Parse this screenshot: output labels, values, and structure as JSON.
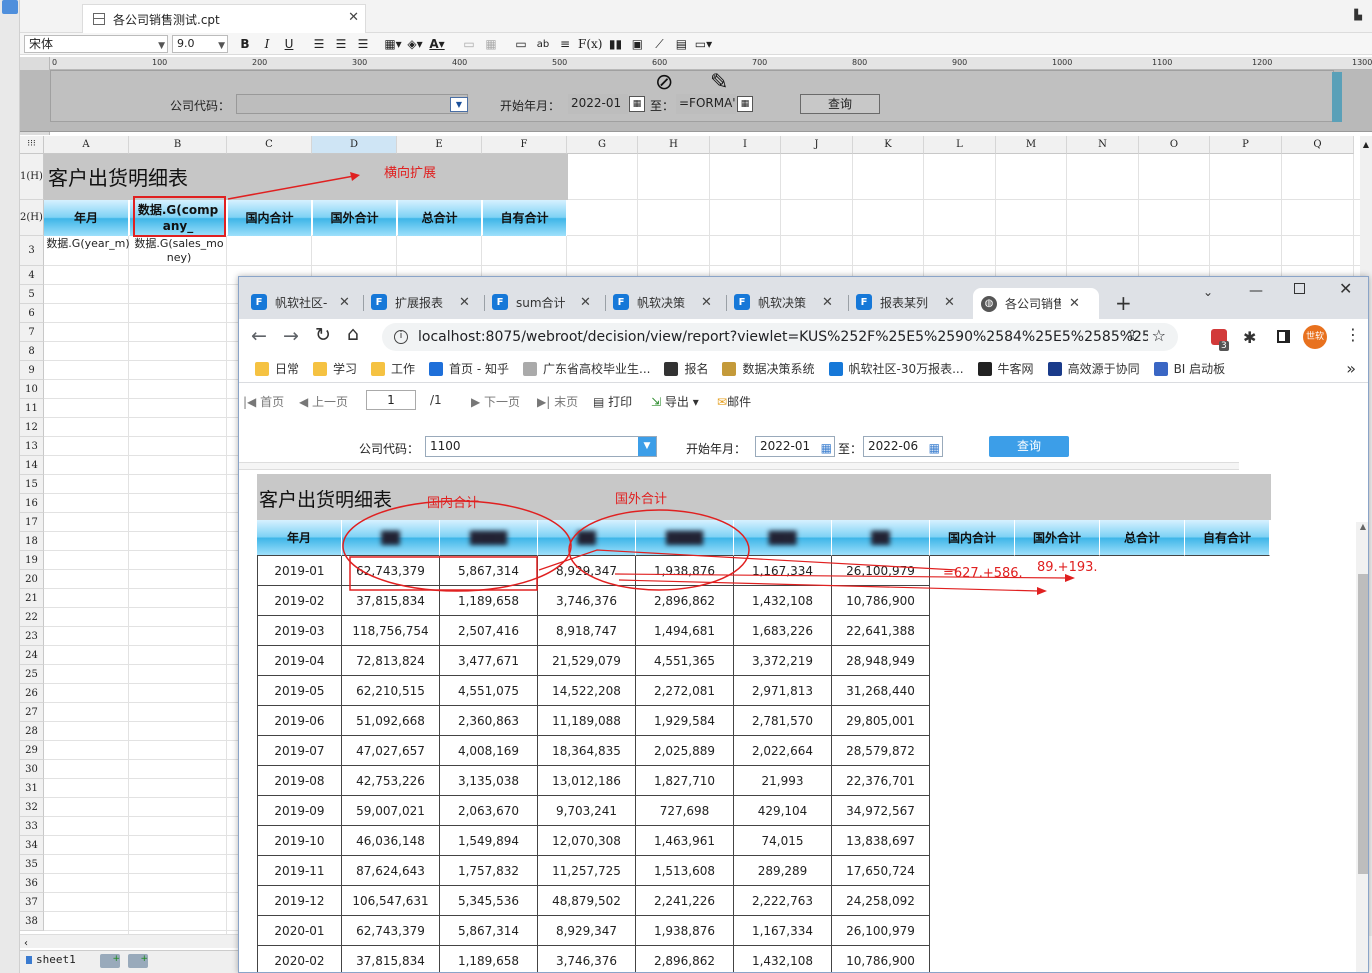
{
  "designer": {
    "file_tab_title": "各公司销售测试.cpt",
    "font_name": "宋体",
    "font_size": "9.0",
    "toolbar_buttons": [
      "B",
      "I",
      "U"
    ],
    "ruler_marks": [
      "0",
      "100",
      "200",
      "300",
      "400",
      "500",
      "600",
      "700",
      "800",
      "900",
      "1000",
      "1100",
      "1200",
      "1300"
    ],
    "param": {
      "company_label": "公司代码：",
      "start_label": "开始年月：",
      "start_value": "2022-01",
      "to_label": "至：",
      "end_value": "=FORMA'",
      "query_button": "查询"
    },
    "columns": [
      "A",
      "B",
      "C",
      "D",
      "E",
      "F",
      "G",
      "H",
      "I",
      "J",
      "K",
      "L",
      "M",
      "N",
      "O",
      "P",
      "Q"
    ],
    "rows": [
      "1(H)",
      "2(H)",
      "3",
      "4",
      "5",
      "6",
      "7",
      "8",
      "9",
      "10",
      "11",
      "12",
      "13",
      "14",
      "15",
      "16",
      "17",
      "18",
      "19",
      "20",
      "21",
      "22",
      "23",
      "24",
      "25",
      "26",
      "27",
      "28",
      "29",
      "30",
      "31",
      "32",
      "33",
      "34",
      "35",
      "36",
      "37",
      "38"
    ],
    "cells": {
      "title": "客户出货明细表",
      "h_year": "年月",
      "h_company": "数据.G(company_",
      "h_domestic": "国内合计",
      "h_foreign": "国外合计",
      "h_total": "总合计",
      "h_own": "自有合计",
      "d_year": "数据.G(year_m)",
      "d_sales": "数据.G(sales_money)"
    },
    "sheet_tab": "sheet1",
    "annotation_expand": "横向扩展"
  },
  "browser": {
    "tabs": [
      {
        "label": "帆软社区-"
      },
      {
        "label": "扩展报表"
      },
      {
        "label": "sum合计"
      },
      {
        "label": "帆软决策"
      },
      {
        "label": "帆软决策"
      },
      {
        "label": "报表某列"
      },
      {
        "label": "各公司销售"
      }
    ],
    "url": "localhost:8075/webroot/decision/view/report?viewlet=KUS%252F%25E5%2590%2584%25E5%2585%25A...",
    "extension_badge": "3",
    "profile_label": "世软",
    "bookmarks": [
      "日常",
      "学习",
      "工作",
      "首页 - 知乎",
      "广东省高校毕业生...",
      "报名",
      "数据决策系统",
      "帆软社区-30万报表...",
      "牛客网",
      "高效源于协同",
      "BI 启动板"
    ],
    "report_toolbar": {
      "first": "首页",
      "prev": "上一页",
      "page_value": "1",
      "page_total": "/1",
      "next": "下一页",
      "last": "末页",
      "print": "打印",
      "export": "导出",
      "mail": "邮件"
    },
    "params": {
      "company_label": "公司代码：",
      "company_value": "1100",
      "start_label": "开始年月：",
      "start_value": "2022-01",
      "to_label": "至：",
      "end_value": "2022-06",
      "query_button": "查询"
    },
    "report": {
      "title": "客户出货明细表",
      "headers": [
        "年月",
        "██",
        "████",
        "██",
        "████",
        "███",
        "██",
        "国内合计",
        "国外合计",
        "总合计",
        "自有合计"
      ],
      "rows": [
        [
          "2019-01",
          "62,743,379",
          "5,867,314",
          "8,929,347",
          "1,938,876",
          "1,167,334",
          "26,100,979"
        ],
        [
          "2019-02",
          "37,815,834",
          "1,189,658",
          "3,746,376",
          "2,896,862",
          "1,432,108",
          "10,786,900"
        ],
        [
          "2019-03",
          "118,756,754",
          "2,507,416",
          "8,918,747",
          "1,494,681",
          "1,683,226",
          "22,641,388"
        ],
        [
          "2019-04",
          "72,813,824",
          "3,477,671",
          "21,529,079",
          "4,551,365",
          "3,372,219",
          "28,948,949"
        ],
        [
          "2019-05",
          "62,210,515",
          "4,551,075",
          "14,522,208",
          "2,272,081",
          "2,971,813",
          "31,268,440"
        ],
        [
          "2019-06",
          "51,092,668",
          "2,360,863",
          "11,189,088",
          "1,929,584",
          "2,781,570",
          "29,805,001"
        ],
        [
          "2019-07",
          "47,027,657",
          "4,008,169",
          "18,364,835",
          "2,025,889",
          "2,022,664",
          "28,579,872"
        ],
        [
          "2019-08",
          "42,753,226",
          "3,135,038",
          "13,012,186",
          "1,827,710",
          "21,993",
          "22,376,701"
        ],
        [
          "2019-09",
          "59,007,021",
          "2,063,670",
          "9,703,241",
          "727,698",
          "429,104",
          "34,972,567"
        ],
        [
          "2019-10",
          "46,036,148",
          "1,549,894",
          "12,070,308",
          "1,463,961",
          "74,015",
          "13,838,697"
        ],
        [
          "2019-11",
          "87,624,643",
          "1,757,832",
          "11,257,725",
          "1,513,608",
          "289,289",
          "17,650,724"
        ],
        [
          "2019-12",
          "106,547,631",
          "5,345,536",
          "48,879,502",
          "2,241,226",
          "2,222,763",
          "24,258,092"
        ],
        [
          "2020-01",
          "62,743,379",
          "5,867,314",
          "8,929,347",
          "1,938,876",
          "1,167,334",
          "26,100,979"
        ],
        [
          "2020-02",
          "37,815,834",
          "1,189,658",
          "3,746,376",
          "2,896,862",
          "1,432,108",
          "10,786,900"
        ]
      ]
    },
    "annotations": {
      "domestic": "国内合计",
      "foreign": "国外合计",
      "formula1": "=627.+586.",
      "formula2": "89.+193."
    }
  },
  "colors": {
    "accent_red": "#e02020",
    "header_blue": "#3fb6e8",
    "query_button": "#3c9ee8"
  }
}
